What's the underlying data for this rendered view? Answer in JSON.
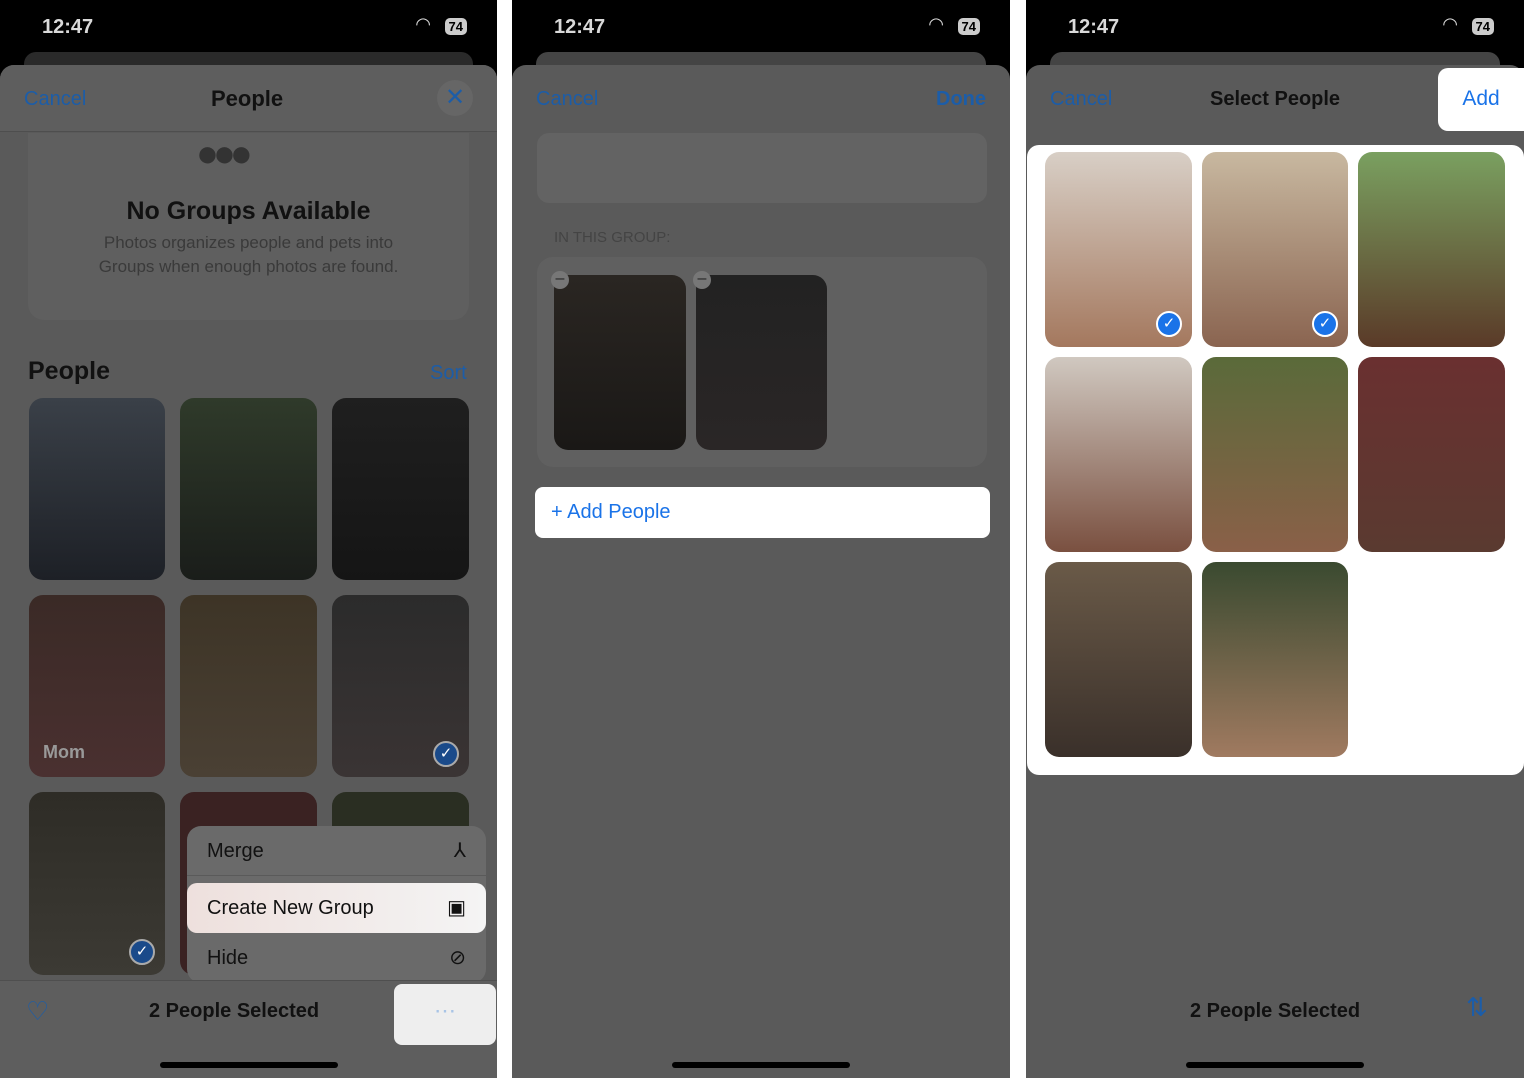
{
  "status": {
    "time": "12:47",
    "battery": "74"
  },
  "panel1": {
    "cancel": "Cancel",
    "title": "People",
    "close_icon": "close-icon",
    "empty_title": "No Groups Available",
    "empty_line1": "Photos organizes people and pets into",
    "empty_line2": "Groups when enough photos are found.",
    "section": "People",
    "sort": "Sort",
    "tile_label_mom": "Mom",
    "menu": [
      {
        "label": "Merge",
        "icon": "merge-icon",
        "glyph": "⅄"
      },
      {
        "label": "Create New Group",
        "icon": "group-icon",
        "glyph": "▣"
      },
      {
        "label": "Hide",
        "icon": "eye-slash-icon",
        "glyph": "⊘"
      }
    ],
    "selected": "2 People Selected"
  },
  "panel2": {
    "cancel": "Cancel",
    "done": "Done",
    "section": "IN THIS GROUP:",
    "add": "+ Add People"
  },
  "panel3": {
    "cancel": "Cancel",
    "title": "Select People",
    "add": "Add",
    "selected": "2 People Selected"
  },
  "colors": {
    "accent": "#1a73e8",
    "dim_accent": "#1c5da8"
  }
}
